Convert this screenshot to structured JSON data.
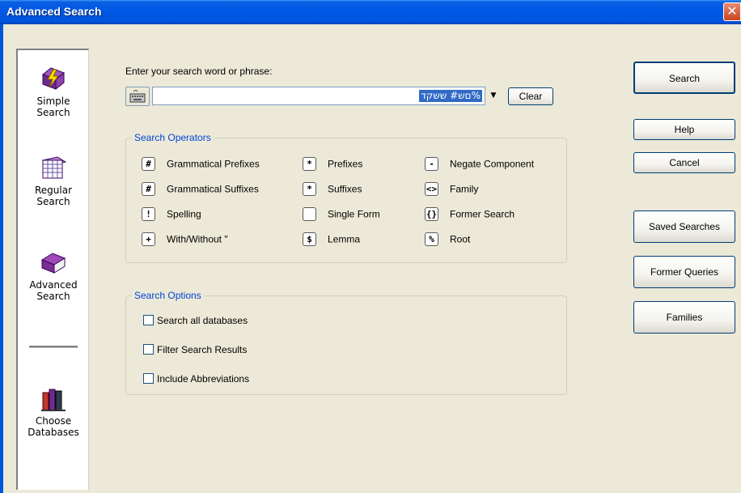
{
  "window": {
    "title": "Advanced Search",
    "close_glyph": "✕"
  },
  "sidebar": {
    "items": [
      {
        "label_line1": "Simple",
        "label_line2": "Search",
        "icon": "lightning-icon"
      },
      {
        "label_line1": "Regular",
        "label_line2": "Search",
        "icon": "grid-calendar-icon"
      },
      {
        "label_line1": "Advanced",
        "label_line2": "Search",
        "icon": "purple-book-icon"
      },
      {
        "label_line1": "Choose",
        "label_line2": "Databases",
        "icon": "books-icon"
      }
    ]
  },
  "search": {
    "prompt": "Enter your search word or phrase:",
    "value": "",
    "hebrew_text": "םש# ששקד%",
    "clear_label": "Clear"
  },
  "operators": {
    "legend": "Search Operators",
    "items": [
      {
        "symbol": "#",
        "label": "Grammatical Prefixes"
      },
      {
        "symbol": "#",
        "label": "Grammatical Suffixes"
      },
      {
        "symbol": "!",
        "label": "Spelling"
      },
      {
        "symbol": "+",
        "label": "With/Without \""
      },
      {
        "symbol": "*",
        "label": "Prefixes"
      },
      {
        "symbol": "*",
        "label": "Suffixes"
      },
      {
        "symbol": "",
        "label": "Single Form"
      },
      {
        "symbol": "$",
        "label": "Lemma"
      },
      {
        "symbol": "-",
        "label": "Negate Component"
      },
      {
        "symbol": "<>",
        "label": "Family"
      },
      {
        "symbol": "{}",
        "label": "Former Search"
      },
      {
        "symbol": "%",
        "label": "Root"
      }
    ]
  },
  "options": {
    "legend": "Search Options",
    "items": [
      {
        "label": "Search all databases",
        "checked": false
      },
      {
        "label": "Filter Search Results",
        "checked": false
      },
      {
        "label": "Include Abbreviations",
        "checked": false
      }
    ]
  },
  "buttons": {
    "search": "Search",
    "help": "Help",
    "cancel": "Cancel",
    "saved_searches": "Saved Searches",
    "former_queries": "Former Queries",
    "families": "Families"
  }
}
